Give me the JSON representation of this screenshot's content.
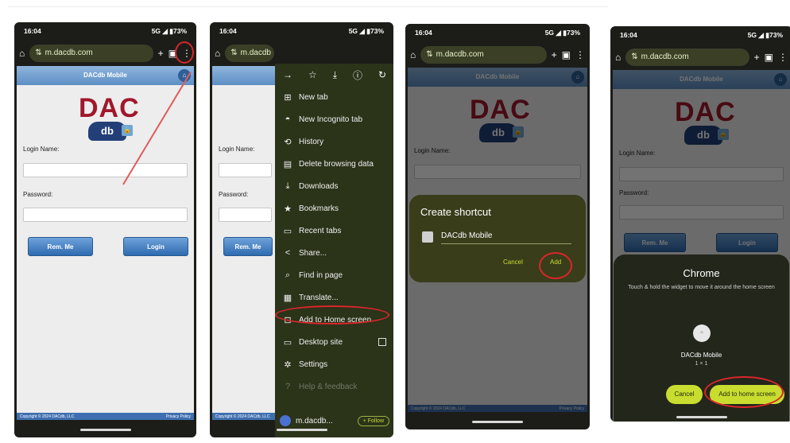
{
  "status": {
    "time": "16:04",
    "network": "5G",
    "battery": "73%"
  },
  "browser": {
    "url": "m.dacdb.com",
    "url_short": "m.dacdb"
  },
  "site": {
    "header_title": "DACdb Mobile",
    "logo_text": "DAC",
    "logo_sub": "db",
    "login_label": "Login Name:",
    "password_label": "Password:",
    "rem_button": "Rem. Me",
    "login_button": "Login",
    "footer_left": "Copyright © 2024 DACdb, LLC",
    "footer_right": "Privacy Policy"
  },
  "menu": {
    "items": [
      {
        "icon": "new-tab-icon",
        "label": "New tab"
      },
      {
        "icon": "incognito-icon",
        "label": "New Incognito tab"
      },
      {
        "icon": "history-icon",
        "label": "History"
      },
      {
        "icon": "trash-icon",
        "label": "Delete browsing data"
      },
      {
        "icon": "download-icon",
        "label": "Downloads"
      },
      {
        "icon": "star-icon",
        "label": "Bookmarks"
      },
      {
        "icon": "recent-tabs-icon",
        "label": "Recent tabs"
      },
      {
        "icon": "share-icon",
        "label": "Share..."
      },
      {
        "icon": "find-icon",
        "label": "Find in page"
      },
      {
        "icon": "translate-icon",
        "label": "Translate..."
      },
      {
        "icon": "add-home-icon",
        "label": "Add to Home screen"
      },
      {
        "icon": "desktop-icon",
        "label": "Desktop site"
      },
      {
        "icon": "settings-icon",
        "label": "Settings"
      },
      {
        "icon": "help-icon",
        "label": "Help & feedback"
      }
    ],
    "site_label": "m.dacdb...",
    "follow_label": "+ Follow"
  },
  "dialog": {
    "title": "Create shortcut",
    "name_value": "DACdb Mobile",
    "cancel": "Cancel",
    "add": "Add"
  },
  "sheet": {
    "title": "Chrome",
    "hint": "Touch & hold the widget to move it around the home screen",
    "widget_name": "DACdb Mobile",
    "widget_size": "1 × 1",
    "cancel": "Cancel",
    "add": "Add to home screen"
  },
  "colors": {
    "highlight": "#d9262b",
    "accent": "#c8dd2f",
    "header": "#5d8fc4",
    "brand": "#a0172b"
  }
}
